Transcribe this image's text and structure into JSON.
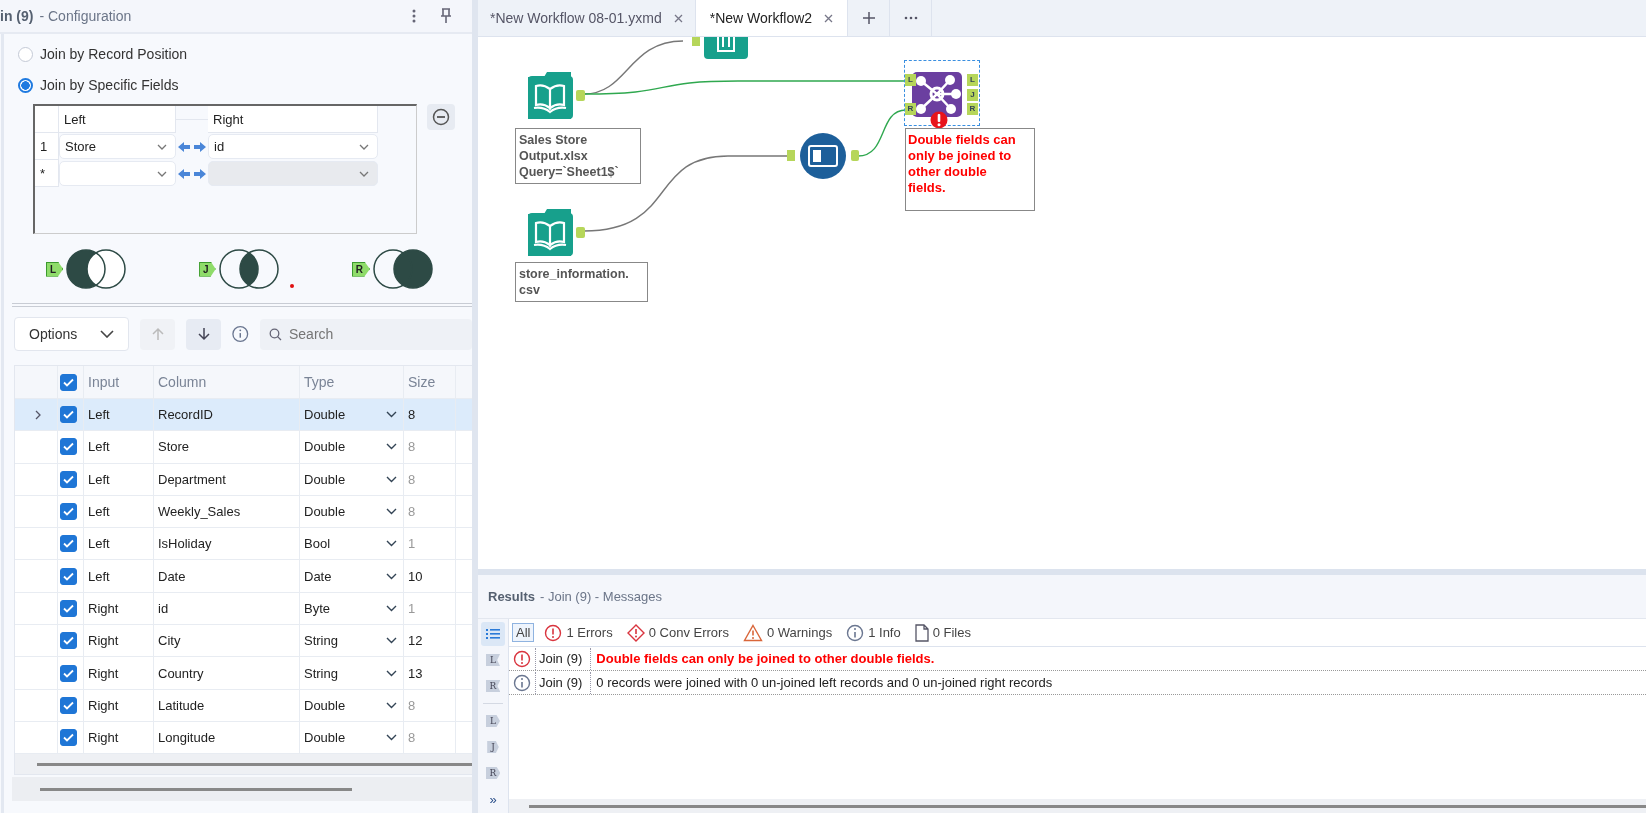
{
  "config_panel": {
    "title": "in (9)",
    "subtitle": "- Configuration"
  },
  "join_modes": [
    {
      "label": "Join by Record Position",
      "selected": false
    },
    {
      "label": "Join by Specific Fields",
      "selected": true
    }
  ],
  "join_fields": {
    "columns": [
      "Left",
      "Right"
    ],
    "rows": [
      {
        "index": "1",
        "left": "Store",
        "right": "id",
        "disabled": false
      },
      {
        "index": "*",
        "disabled": true
      }
    ]
  },
  "outputs": [
    {
      "kind": "left",
      "label": "L",
      "flagged": false
    },
    {
      "kind": "inner",
      "label": "J",
      "flagged": true
    },
    {
      "kind": "right",
      "label": "R",
      "flagged": false
    }
  ],
  "toolbar": {
    "dropdown": "Options",
    "search_placeholder": "Search",
    "up_disabled": true
  },
  "fields_table": {
    "all_checked": true,
    "columns": [
      "Input",
      "Column",
      "Type",
      "Size"
    ],
    "rows": [
      {
        "selected": true,
        "checked": true,
        "input": "Left",
        "column": "RecordID",
        "type": "Double",
        "size": "8",
        "size_editable": true
      },
      {
        "selected": false,
        "checked": true,
        "input": "Left",
        "column": "Store",
        "type": "Double",
        "size": "8",
        "size_editable": false
      },
      {
        "selected": false,
        "checked": true,
        "input": "Left",
        "column": "Department",
        "type": "Double",
        "size": "8",
        "size_editable": false
      },
      {
        "selected": false,
        "checked": true,
        "input": "Left",
        "column": "Weekly_Sales",
        "type": "Double",
        "size": "8",
        "size_editable": false
      },
      {
        "selected": false,
        "checked": true,
        "input": "Left",
        "column": "IsHoliday",
        "type": "Bool",
        "size": "1",
        "size_editable": false
      },
      {
        "selected": false,
        "checked": true,
        "input": "Left",
        "column": "Date",
        "type": "Date",
        "size": "10",
        "size_editable": true
      },
      {
        "selected": false,
        "checked": true,
        "input": "Right",
        "column": "id",
        "type": "Byte",
        "size": "1",
        "size_editable": false
      },
      {
        "selected": false,
        "checked": true,
        "input": "Right",
        "column": "City",
        "type": "String",
        "size": "12",
        "size_editable": true
      },
      {
        "selected": false,
        "checked": true,
        "input": "Right",
        "column": "Country",
        "type": "String",
        "size": "13",
        "size_editable": true
      },
      {
        "selected": false,
        "checked": true,
        "input": "Right",
        "column": "Latitude",
        "type": "Double",
        "size": "8",
        "size_editable": false
      },
      {
        "selected": false,
        "checked": true,
        "input": "Right",
        "column": "Longitude",
        "type": "Double",
        "size": "8",
        "size_editable": false
      }
    ]
  },
  "tabs": [
    {
      "label": "*New Workflow 08-01.yxmd",
      "selected": false
    },
    {
      "label": "*New Workflow2",
      "selected": true
    }
  ],
  "canvas": {
    "nodes": [
      {
        "kind": "partial"
      },
      {
        "kind": "input",
        "lines": [
          "Sales Store",
          "Output.xlsx",
          "Query=`Sheet1$`"
        ]
      },
      {
        "kind": "input",
        "lines": [
          "store_information.",
          "csv"
        ]
      },
      {
        "kind": "transform"
      },
      {
        "kind": "join",
        "selected": true,
        "error": true,
        "inputs": [
          "L",
          "R"
        ],
        "outputs": [
          "L",
          "J",
          "R"
        ],
        "message": "Double fields can only be joined to other double fields."
      }
    ]
  },
  "results": {
    "title": "Results",
    "subtitle": "- Join (9) - Messages",
    "side_tools": [
      {
        "kind": "list",
        "selected": true
      },
      {
        "kind": "tag",
        "label": "L",
        "selected": false
      },
      {
        "kind": "tag",
        "label": "R",
        "selected": false
      },
      {
        "kind": "anchor",
        "label": "L",
        "selected": false
      },
      {
        "kind": "anchor",
        "label": "J",
        "selected": false
      },
      {
        "kind": "anchor",
        "label": "R",
        "selected": false
      },
      {
        "kind": "more",
        "label": "»",
        "selected": false
      }
    ],
    "filters": [
      {
        "kind": "all",
        "label": "All",
        "selected": true
      },
      {
        "kind": "error",
        "label": "1 Errors",
        "selected": false
      },
      {
        "kind": "conv",
        "label": "0 Conv Errors",
        "selected": false
      },
      {
        "kind": "warning",
        "label": "0 Warnings",
        "selected": false
      },
      {
        "kind": "info",
        "label": "1 Info",
        "selected": false
      },
      {
        "kind": "file",
        "label": "0 Files",
        "selected": false
      }
    ],
    "messages": [
      {
        "kind": "error",
        "tool": "Join (9)",
        "text": "Double fields can only be joined to other double fields."
      },
      {
        "kind": "info",
        "tool": "Join (9)",
        "text": "0 records were joined with 0 un-joined left records and 0 un-joined right records"
      }
    ]
  }
}
